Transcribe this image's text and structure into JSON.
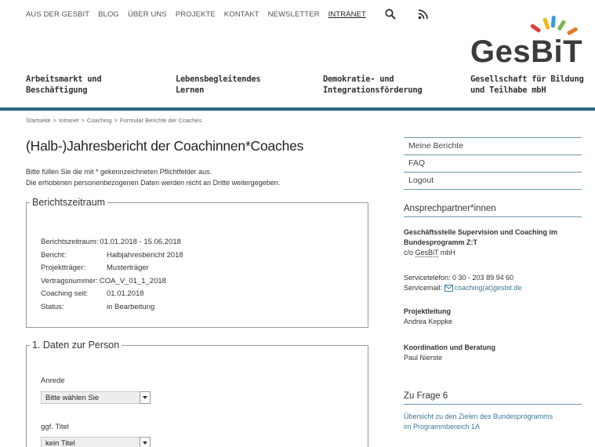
{
  "topnav": {
    "items": [
      "AUS DER GESBIT",
      "BLOG",
      "ÜBER UNS",
      "PROJEKTE",
      "KONTAKT",
      "NEWSLETTER",
      "INTRANET"
    ],
    "active": "INTRANET",
    "icons": [
      "search-icon",
      "rss-icon"
    ]
  },
  "logo": {
    "word": "GesBiT",
    "tagline": "Gesellschaft für Bildung\nund Teilhabe mbH",
    "ray_colors": [
      "#e23b3b",
      "#f2b619",
      "#3a9bd6",
      "#7ab648",
      "#e37c2b"
    ]
  },
  "categories": [
    "Arbeitsmarkt und\nBeschäftigung",
    "Lebensbegleitendes\nLernen",
    "Demokratie- und\nIntegrationsförderung"
  ],
  "breadcrumb": [
    "Startseite",
    "Intranet",
    "Coaching",
    "Formular Berichte der Coaches"
  ],
  "breadcrumb_sep": ">",
  "page": {
    "title": "(Halb-)Jahresbericht der Coachinnen*Coaches",
    "intro_line1": "Bitte füllen Sie die mit * gekennzeichneten Pflichtfelder aus.",
    "intro_line2": "Die erhobenen personenbezogenen Daten werden nicht an Dritte weitergegeben."
  },
  "berichtszeitraum": {
    "legend": "Berichtszeitraum",
    "rows": [
      {
        "key": "Berichtszeitraum:",
        "value": "01.01.2018 - 15.06.2018"
      },
      {
        "key": "Bericht:",
        "value": "Halbjahresbericht 2018"
      },
      {
        "key": "Projektträger:",
        "value": "Musterträger"
      },
      {
        "key": "Vertragsnummer:",
        "value": "COA_V_01_1_2018"
      },
      {
        "key": "Coaching seit:",
        "value": "01.01.2018"
      },
      {
        "key": "Status:",
        "value": "in Bearbeitung"
      }
    ]
  },
  "person": {
    "legend": "1. Daten zur Person",
    "anrede_label": "Anrede",
    "anrede_value": "Bitte wählen Sie",
    "titel_label": "ggf. Titel",
    "titel_value": "kein Titel"
  },
  "sidebar": {
    "menu": [
      "Meine Berichte",
      "FAQ",
      "Logout"
    ],
    "contacts_heading": "Ansprechpartner*innen",
    "office_line1": "Geschäftsstelle Supervision und Coaching im",
    "office_line2": "Bundesprogramm Z:T",
    "office_line3_prefix": "c/o ",
    "office_line3_abbr": "GesBiT",
    "office_line3_suffix": " mbH",
    "phone": "Servicetelefon: 0 30 - 203 89 94 60",
    "email_label": "Servicemail: ",
    "email": "coaching(at)gesbit.de",
    "projektleitung_label": "Projektleitung",
    "projektleitung_name": "Andrea Keppke",
    "koordination_label": "Koordination und Beratung",
    "koordination_name": "Paul Nierste",
    "frage_heading": "Zu Frage 6",
    "frage_link_line1": "Übersicht zu den Zielen des Bundesprogramms",
    "frage_link_line2": "im Programmbereich 1A"
  }
}
